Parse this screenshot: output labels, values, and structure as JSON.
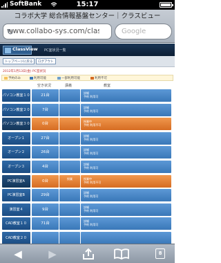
{
  "status": {
    "carrier": "SoftBank",
    "time": "15:17"
  },
  "browser": {
    "title": "コラボ大学 総合情報基盤センター｜クラスビュー",
    "url": "www.collabo-sys.com/clas",
    "search_placeholder": "Google"
  },
  "site": {
    "logo": "ClassView",
    "page_name": "PC室状況一覧",
    "nav": [
      "トップページに戻る",
      "ログアウト"
    ],
    "notice": "2012年1月13日(金) PC室状況",
    "legend": [
      "予約のみ",
      "利用可能",
      "一部利用可能",
      "利用不可"
    ],
    "headers": [
      "空き状況",
      "講義",
      "教室"
    ]
  },
  "rows": [
    {
      "name": "パソコン教室１０",
      "count": "21台",
      "mid": "",
      "detail": [
        "詳細",
        "予約",
        "利用可"
      ],
      "style": "blue"
    },
    {
      "name": "パソコン教室２０",
      "count": "7台",
      "mid": "",
      "detail": [
        "詳細",
        "予約",
        "利用可"
      ],
      "style": "blue"
    },
    {
      "name": "パソコン教室３０",
      "count": "0台",
      "mid": "",
      "detail": [
        "授業中",
        "予約",
        "利用不可"
      ],
      "style": "orange"
    },
    {
      "name": "オープン１",
      "count": "27台",
      "mid": "",
      "detail": [
        "詳細",
        "予約",
        "利用可"
      ],
      "style": "blue"
    },
    {
      "name": "オープン２",
      "count": "26台",
      "mid": "",
      "detail": [
        "詳細",
        "予約",
        "利用可"
      ],
      "style": "blue"
    },
    {
      "name": "オープン３",
      "count": "4台",
      "mid": "",
      "detail": [
        "詳細",
        "予約",
        "利用可"
      ],
      "style": "blue"
    },
    {
      "name": "PC演習室A",
      "count": "0台",
      "mid": "授業",
      "detail": [
        "授業中",
        "予約",
        "利用不可"
      ],
      "style": "orange"
    },
    {
      "name": "PC演習室B",
      "count": "29台",
      "mid": "",
      "detail": [
        "詳細",
        "予約",
        "利用可"
      ],
      "style": "blue"
    },
    {
      "name": "演習室４",
      "count": "9台",
      "mid": "",
      "detail": [
        "詳細",
        "予約",
        "利用可"
      ],
      "style": "blue"
    },
    {
      "name": "CAD教室１０",
      "count": "71台",
      "mid": "",
      "detail": [
        "詳細",
        "予約",
        "利用可"
      ],
      "style": "blue"
    },
    {
      "name": "CAD教室２０",
      "count": "",
      "mid": "",
      "detail": [
        "",
        "",
        ""
      ],
      "style": "blue"
    }
  ],
  "toolbar": {
    "tab_count": "8"
  },
  "colors": {
    "accent": "#3a78b8",
    "busy": "#d66c22",
    "chrome": "#a9b2bd"
  }
}
